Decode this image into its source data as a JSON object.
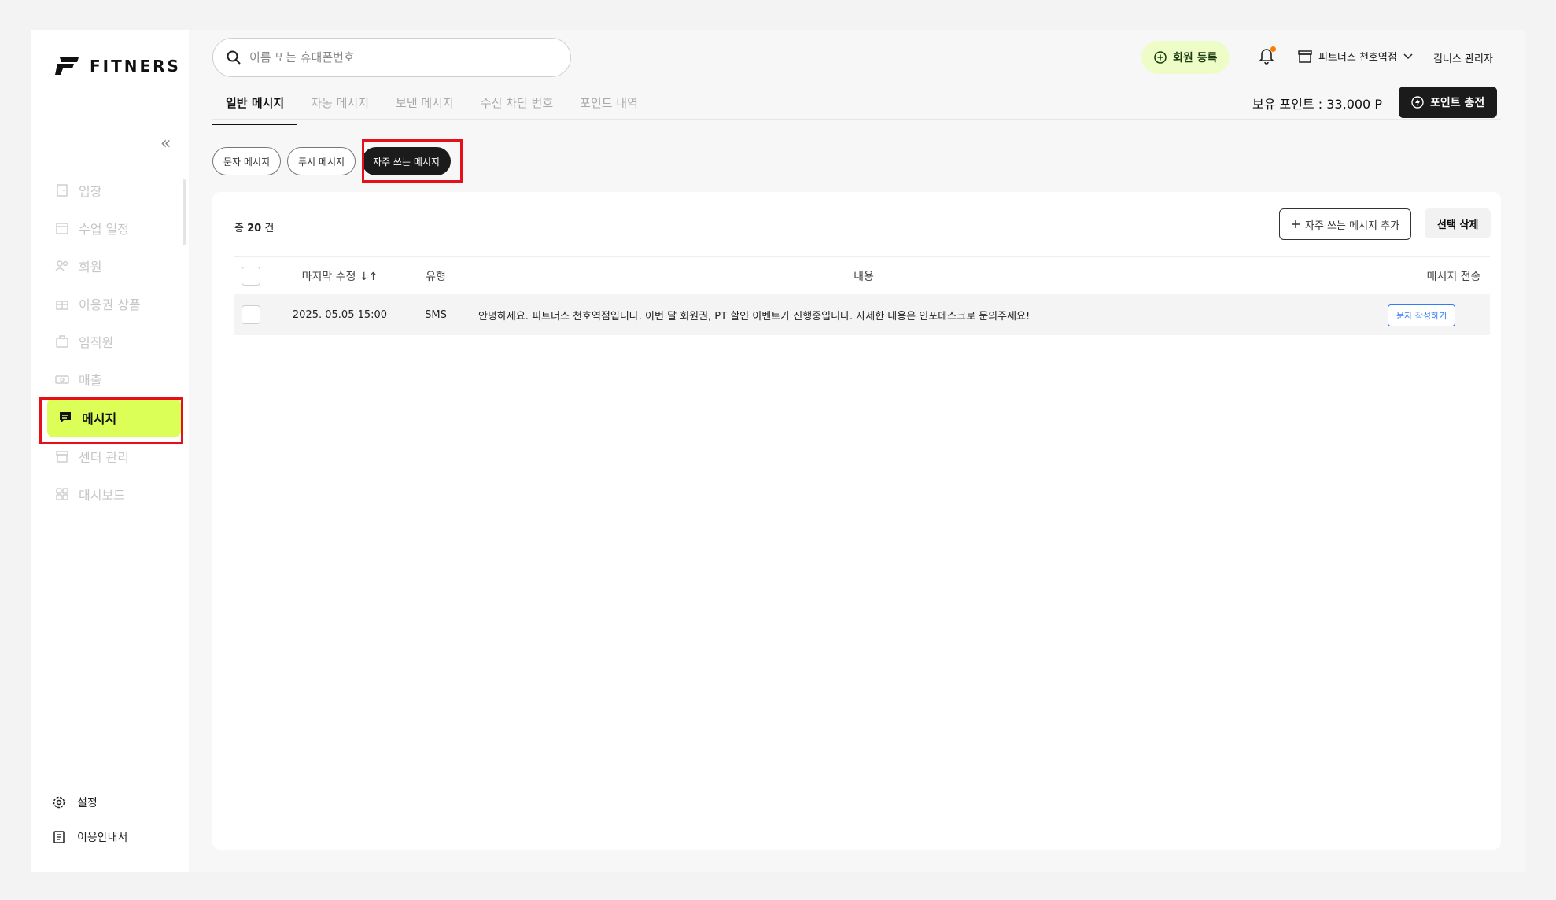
{
  "brand": {
    "name": "FITNERS"
  },
  "sidebar": {
    "items": [
      {
        "label": "입장",
        "icon": "door-icon"
      },
      {
        "label": "수업 일정",
        "icon": "calendar-icon"
      },
      {
        "label": "회원",
        "icon": "members-icon"
      },
      {
        "label": "이용권 상품",
        "icon": "gift-icon"
      },
      {
        "label": "임직원",
        "icon": "briefcase-icon"
      },
      {
        "label": "매출",
        "icon": "cash-icon"
      },
      {
        "label": "메시지",
        "icon": "message-icon",
        "active": true
      },
      {
        "label": "센터 관리",
        "icon": "store-icon"
      },
      {
        "label": "대시보드",
        "icon": "grid-icon"
      }
    ],
    "settings_label": "설정",
    "guide_label": "이용안내서"
  },
  "header": {
    "search_placeholder": "이름 또는 휴대폰번호",
    "register_label": "회원 등록",
    "store_label": "피트너스 천호역점",
    "admin_label": "김너스 관리자",
    "points_text": "보유 포인트 : 33,000 P",
    "charge_label": "포인트 충전"
  },
  "tabs": [
    "일반 메시지",
    "자동 메시지",
    "보낸 메시지",
    "수신 차단 번호",
    "포인트 내역"
  ],
  "pills": [
    "문자 메시지",
    "푸시 메시지",
    "자주 쓰는 메시지"
  ],
  "list": {
    "total_prefix": "총",
    "total_count": "20",
    "total_suffix": "건",
    "add_label": "자주 쓰는 메시지 추가",
    "delete_label": "선택 삭제",
    "columns": {
      "date": "마지막 수정",
      "type": "유형",
      "content": "내용",
      "send": "메시지 전송"
    },
    "rows": [
      {
        "date": "2025. 05.05 15:00",
        "type": "SMS",
        "content": "안녕하세요. 피트너스 천호역점입니다. 이번 달 회원권, PT 할인 이벤트가 진행중입니다. 자세한 내용은 인포데스크로 문의주세요!",
        "action": "문자 작성하기"
      }
    ]
  },
  "colors": {
    "accent": "#dcff57",
    "highlight": "#e5101a",
    "dark": "#1b1b1b",
    "link": "#2f7cf6"
  }
}
